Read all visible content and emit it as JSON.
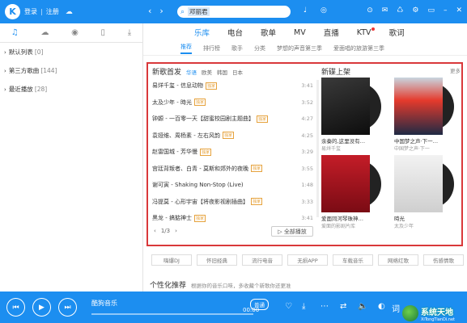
{
  "topbar": {
    "logo_letter": "K",
    "login": "登录",
    "sep": "|",
    "register": "注册",
    "search_query": "邓丽君",
    "nav_back": "‹",
    "nav_forward": "›"
  },
  "sidebar": {
    "tabs": [
      "music-note",
      "cloud",
      "radio",
      "phone",
      "download"
    ],
    "items": [
      {
        "label": "默认列表",
        "count": "[0]"
      },
      {
        "label": "第三方歌曲",
        "count": "[144]"
      },
      {
        "label": "最近播放",
        "count": "[28]"
      }
    ]
  },
  "main": {
    "tabs": [
      "乐库",
      "电台",
      "歌单",
      "MV",
      "直播",
      "KTV",
      "歌词"
    ],
    "subtabs": [
      "推荐",
      "排行榜",
      "歌手",
      "分类",
      "梦想的声音第三季",
      "爱面唱的旅游第三季"
    ],
    "new_songs": {
      "title": "新歌首发",
      "categories": [
        "华语",
        "欧美",
        "韩国",
        "日本"
      ],
      "songs": [
        {
          "name": "易烊千玺 - 信息动物",
          "tag": "独家",
          "dur": "3:41"
        },
        {
          "name": "太及少年 - 時光",
          "tag": "独家",
          "dur": "3:52"
        },
        {
          "name": "钟嫄 - 一百零一天【甜蜜校园剧主题曲】",
          "tag": "独家",
          "dur": "4:27"
        },
        {
          "name": "袁娅维、周杨素 - 左右风韵",
          "tag": "独家",
          "dur": "4:25"
        },
        {
          "name": "赵雷国城 - 芳华慢",
          "tag": "独家",
          "dur": "3:29"
        },
        {
          "name": "宫廷背叛者、白青 - 莫斯和郊外的夜晚",
          "tag": "独家",
          "dur": "3:55"
        },
        {
          "name": "谢可寅 - Shaking Non-Stop (Live)",
          "tag": "",
          "dur": "1:48"
        },
        {
          "name": "冯提莫 - 心形宇宙【将夜影视剧插曲】",
          "tag": "独家",
          "dur": "3:33"
        },
        {
          "name": "黑龙 - 搞掂神士",
          "tag": "独家",
          "dur": "3:41"
        }
      ],
      "pager": "1/3",
      "play_all": "全部播放"
    },
    "new_albums": {
      "title": "新碟上架",
      "more": "更多",
      "albums": [
        {
          "title": "余秦的,这里没有…",
          "artist": "易烊千玺"
        },
        {
          "title": "中国梦之声·下一…",
          "artist": "中国梦之声·下一"
        },
        {
          "title": "爱面同河琴珠神…",
          "artist": "爱面的影剧片库"
        },
        {
          "title": "時光",
          "artist": "太及少年"
        }
      ]
    },
    "genre_tags": [
      "嗨爆DJ",
      "怀旧经典",
      "流行电音",
      "无损APP",
      "车载音乐",
      "网络红歌",
      "伤感情歌"
    ],
    "personal": {
      "title": "个性化推荐",
      "desc": "根据你的音乐口味，多收藏个新歌你还更准"
    }
  },
  "player": {
    "title": "酷狗音乐",
    "quality": "普通",
    "time": "00:00",
    "lyrics_btn": "词"
  },
  "watermark": {
    "title": "系统天地",
    "sub": "XiTongTianDi.net"
  }
}
